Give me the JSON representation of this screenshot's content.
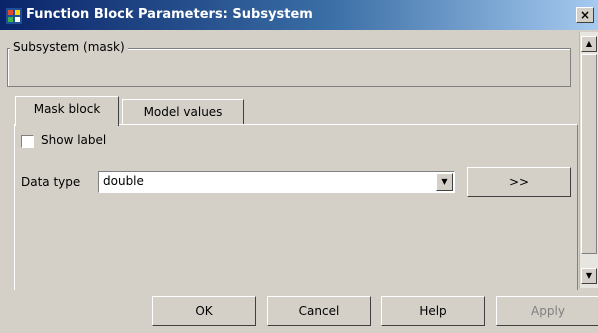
{
  "window": {
    "title": "Function Block Parameters: Subsystem",
    "close_label": "×"
  },
  "group": {
    "title": "Subsystem (mask)"
  },
  "tabs": [
    {
      "label": "Mask block",
      "selected": true
    },
    {
      "label": "Model values",
      "selected": false
    }
  ],
  "show_label": {
    "label": "Show label",
    "checked": false
  },
  "data_type": {
    "label": "Data type",
    "value": "double",
    "more_button": ">>"
  },
  "buttons": {
    "ok": "OK",
    "cancel": "Cancel",
    "help": "Help",
    "apply": "Apply"
  }
}
